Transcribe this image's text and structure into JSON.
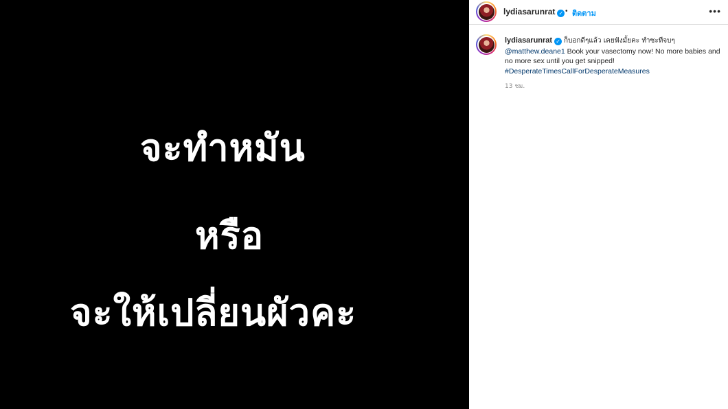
{
  "media": {
    "lines": [
      "จะทำหมัน",
      "หรือ",
      "จะให้เปลี่ยนผัวคะ"
    ]
  },
  "header": {
    "username": "lydiasarunrat",
    "separator": "•",
    "follow_label": "ติดตาม",
    "more_label": "•••"
  },
  "caption": {
    "username": "lydiasarunrat",
    "thai_text": "ก็บอกดีๆแล้ว เคยฟังมั้ยคะ ทำซะทีจบๆ",
    "mention": "@matthew.deane1",
    "text": " Book your vasectomy now! No more babies and no more sex until you get snipped!",
    "hashtag": "#DesperateTimesCallForDesperateMeasures",
    "time": "13 ชม."
  },
  "colors": {
    "accent": "#0095f6",
    "link": "#00376b",
    "media_bg": "#000000"
  },
  "icons": {
    "verified": "verified-badge-icon",
    "more": "more-options-icon"
  }
}
